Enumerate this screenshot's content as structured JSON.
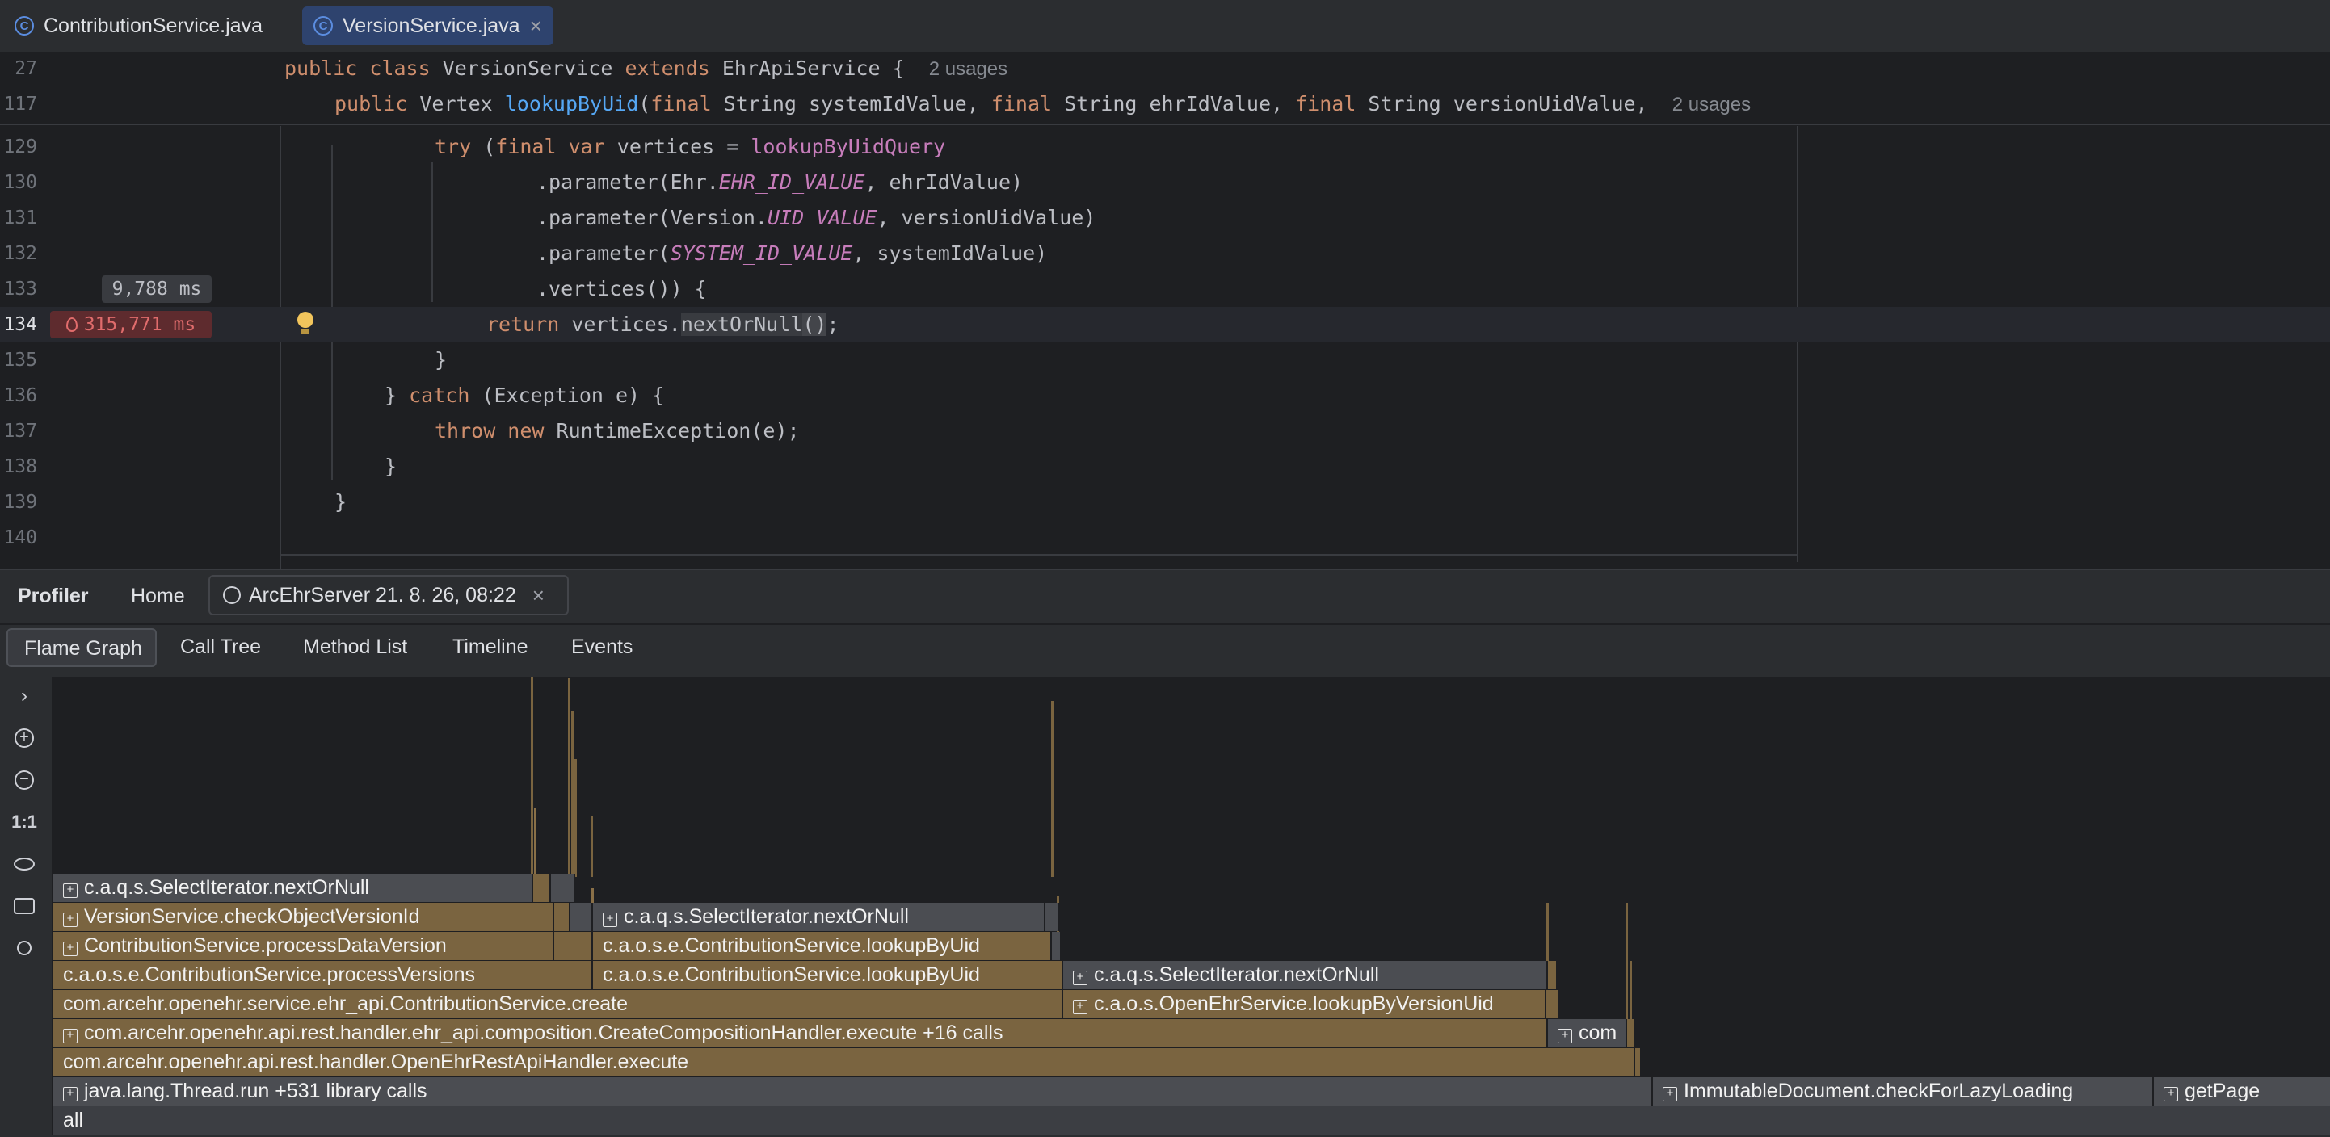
{
  "tabs": [
    {
      "label": "ContributionService.java"
    },
    {
      "label": "VersionService.java"
    }
  ],
  "editor": {
    "sticky": [
      {
        "line": "27",
        "text": "public class VersionService extends EhrApiService {",
        "usages": "2 usages"
      },
      {
        "line": "117",
        "text": "public Vertex lookupByUid(final String systemIdValue, final String ehrIdValue, final String versionUidValue,",
        "usages": "2 usages"
      }
    ],
    "line_numbers": [
      "129",
      "130",
      "131",
      "132",
      "133",
      "134",
      "135",
      "136",
      "137",
      "138",
      "139",
      "140"
    ],
    "code_lines": [
      "try (final var vertices = lookupByUidQuery",
      ".parameter(Ehr.EHR_ID_VALUE, ehrIdValue)",
      ".parameter(Version.UID_VALUE, versionUidValue)",
      ".parameter(SYSTEM_ID_VALUE, systemIdValue)",
      ".vertices()) {",
      "return vertices.nextOrNull();",
      "}",
      "} catch (Exception e) {",
      "throw new RuntimeException(e);",
      "}",
      "}",
      ""
    ],
    "timing_133": "9,788 ms",
    "timing_134": "315,771 ms",
    "hot_icon": "flame-icon",
    "intention_icon": "lightbulb-icon"
  },
  "profiler": {
    "title": "Profiler",
    "home": "Home",
    "session": "ArcEhrServer 21. 8. 26, 08:22",
    "view_tabs": [
      "Flame Graph",
      "Call Tree",
      "Method List",
      "Timeline",
      "Events"
    ],
    "active_view": "Flame Graph",
    "tools": [
      "expand-icon",
      "zoom-in-icon",
      "zoom-out-icon",
      "reset-zoom-icon",
      "eye-icon",
      "camera-icon",
      "search-icon"
    ],
    "reset_zoom_label": "1:1",
    "frames": [
      "c.a.q.s.SelectIterator.nextOrNull",
      "VersionService.checkObjectVersionId",
      "ContributionService.processDataVersion",
      "c.a.o.s.e.ContributionService.processVersions",
      "com.arcehr.openehr.service.ehr_api.ContributionService.create",
      "com.arcehr.openehr.api.rest.handler.ehr_api.composition.CreateCompositionHandler.execute +16 calls",
      "com.arcehr.openehr.api.rest.handler.OpenEhrRestApiHandler.execute",
      "java.lang.Thread.run +531 library calls",
      "all",
      "c.a.q.s.SelectIterator.nextOrNull",
      "c.a.o.s.e.ContributionService.lookupByUid",
      "c.a.o.s.e.ContributionService.lookupByUid",
      "c.a.q.s.SelectIterator.nextOrNull",
      "c.a.o.s.OpenEhrService.lookupByVersionUid",
      "com",
      "ImmutableDocument.checkForLazyLoading",
      "getPage"
    ]
  },
  "colors": {
    "frame_gold": "#7a6440",
    "frame_grey": "#4b4d52",
    "keyword": "#cf8e6d",
    "hot": "#e06c6c"
  }
}
